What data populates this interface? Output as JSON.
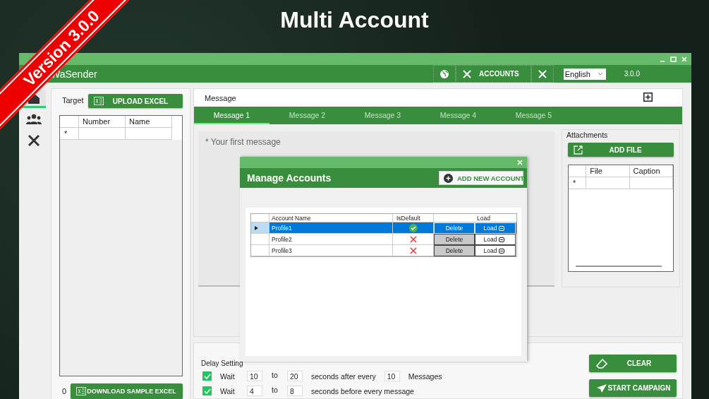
{
  "banner": {
    "title": "Multi Account",
    "ribbon": "Version 3.0.0"
  },
  "window": {
    "title": "WaSender",
    "accounts": "ACCOUNTS",
    "language": "English",
    "version": "3.0.0"
  },
  "sidebar": {
    "items": [
      {
        "kind": "home",
        "selected": true
      },
      {
        "kind": "users",
        "selected": false
      },
      {
        "kind": "tools",
        "selected": false
      }
    ]
  },
  "target": {
    "label": "Target",
    "upload": "UPLOAD EXCEL",
    "columns": [
      "Number",
      "Name"
    ],
    "new_row": "*",
    "count": "0",
    "download": "DOWNLOAD SAMPLE EXCEL"
  },
  "message": {
    "label": "Message",
    "tabs": [
      {
        "label": "Message 1",
        "selected": true
      },
      {
        "label": "Message 2",
        "selected": false
      },
      {
        "label": "Message 3",
        "selected": false
      },
      {
        "label": "Message 4",
        "selected": false
      },
      {
        "label": "Message 5",
        "selected": false
      }
    ],
    "placeholder": "* Your first message",
    "attachments": {
      "label": "Attachments",
      "add": "ADD FILE",
      "columns": [
        "File",
        "Caption"
      ],
      "new_row": "*"
    }
  },
  "modal": {
    "title": "Manage Accounts",
    "add": "ADD NEW ACCOUNT",
    "columns": {
      "name": "Account Name",
      "default": "IsDefault",
      "load": "Load"
    },
    "rows": [
      {
        "name": "Profile1",
        "is_default": true,
        "selected": true,
        "delete": "Delete",
        "load": "Load"
      },
      {
        "name": "Profile2",
        "is_default": false,
        "selected": false,
        "delete": "Delete",
        "load": "Load"
      },
      {
        "name": "Profile3",
        "is_default": false,
        "selected": false,
        "delete": "Delete",
        "load": "Load"
      }
    ]
  },
  "delay": {
    "label": "Delay Setting",
    "rows": [
      {
        "checked": true,
        "wait": "Wait",
        "from": "10",
        "to_label": "to",
        "to": "20",
        "text": "seconds after every",
        "count": "10",
        "unit": "Messages"
      },
      {
        "checked": true,
        "wait": "Wait",
        "from": "4",
        "to_label": "to",
        "to": "8",
        "text": "seconds before every message"
      }
    ]
  },
  "actions": [
    {
      "kind": "clear",
      "label": "CLEAR"
    },
    {
      "kind": "send",
      "label": "START CAMPAIGN"
    }
  ]
}
